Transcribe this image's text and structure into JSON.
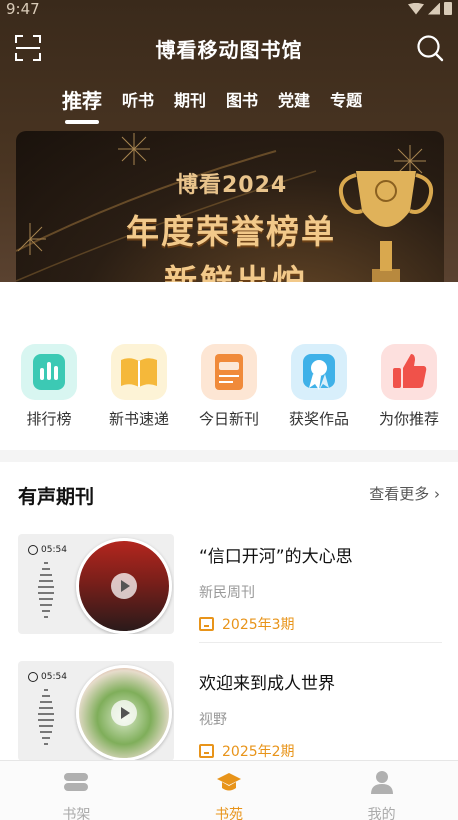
{
  "status": {
    "time": "9:47"
  },
  "header": {
    "title": "博看移动图书馆"
  },
  "tabs": [
    {
      "label": "推荐",
      "active": true
    },
    {
      "label": "听书"
    },
    {
      "label": "期刊"
    },
    {
      "label": "图书"
    },
    {
      "label": "党建"
    },
    {
      "label": "专题"
    }
  ],
  "banner": {
    "subtitle": "博看2024",
    "line1": "年度荣誉榜单",
    "line2": "新鲜出炉",
    "page_count": 2,
    "current_page": 1
  },
  "quick_links": [
    {
      "label": "排行榜",
      "icon": "chart-bars-icon",
      "color": "#3cc9b4"
    },
    {
      "label": "新书速递",
      "icon": "open-book-icon",
      "color": "#f5b83a"
    },
    {
      "label": "今日新刊",
      "icon": "new-magazine-icon",
      "color": "#f08a3a"
    },
    {
      "label": "获奖作品",
      "icon": "award-ribbon-icon",
      "color": "#3fb1e8"
    },
    {
      "label": "为你推荐",
      "icon": "thumbs-up-icon",
      "color": "#f0524a"
    }
  ],
  "audio_section": {
    "title": "有声期刊",
    "more": "查看更多",
    "items": [
      {
        "duration": "05:54",
        "title": "“信口开河”的大心思",
        "magazine": "新民周刊",
        "issue": "2025年3期"
      },
      {
        "duration": "05:54",
        "title": "欢迎来到成人世界",
        "magazine": "视野",
        "issue": "2025年2期"
      }
    ]
  },
  "bottom_nav": [
    {
      "label": "书架",
      "icon": "bookshelf-icon"
    },
    {
      "label": "书苑",
      "icon": "graduation-cap-icon",
      "active": true
    },
    {
      "label": "我的",
      "icon": "person-icon"
    }
  ],
  "colors": {
    "accent": "#e8941a",
    "header": "#3a2a1b"
  }
}
